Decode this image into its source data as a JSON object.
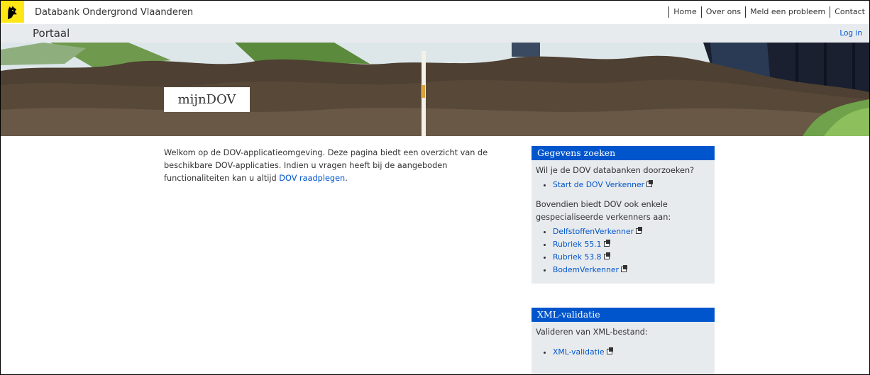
{
  "header": {
    "site_title": "Databank Ondergrond Vlaanderen",
    "links": [
      "Home",
      "Over ons",
      "Meld een probleem",
      "Contact"
    ],
    "logo_colors": {
      "background": "#ffe615"
    }
  },
  "portal": {
    "title": "Portaal",
    "login": "Log in"
  },
  "hero": {
    "label": "mijnDOV"
  },
  "intro": {
    "text": "Welkom op de DOV-applicatieomgeving. Deze pagina biedt een overzicht van de beschikbare DOV-applicaties. Indien u vragen heeft bij de aangeboden functionaliteiten kan u altijd ",
    "link": "DOV raadplegen",
    "end": "."
  },
  "search_card": {
    "title": "Gegevens zoeken",
    "question": "Wil je de DOV databanken doorzoeken?",
    "main_link": "Start de DOV Verkenner",
    "extra_text": "Bovendien biedt DOV ook enkele gespecialiseerde verkenners aan:",
    "links": [
      "DelfstoffenVerkenner",
      "Rubriek 55.1",
      "Rubriek 53.8",
      "BodemVerkenner"
    ]
  },
  "xml_card": {
    "title": "XML-validatie",
    "text": "Valideren van XML-bestand:",
    "link": "XML-validatie"
  },
  "colors": {
    "accent": "#0055cc",
    "panel_bg": "#e8ebee"
  }
}
